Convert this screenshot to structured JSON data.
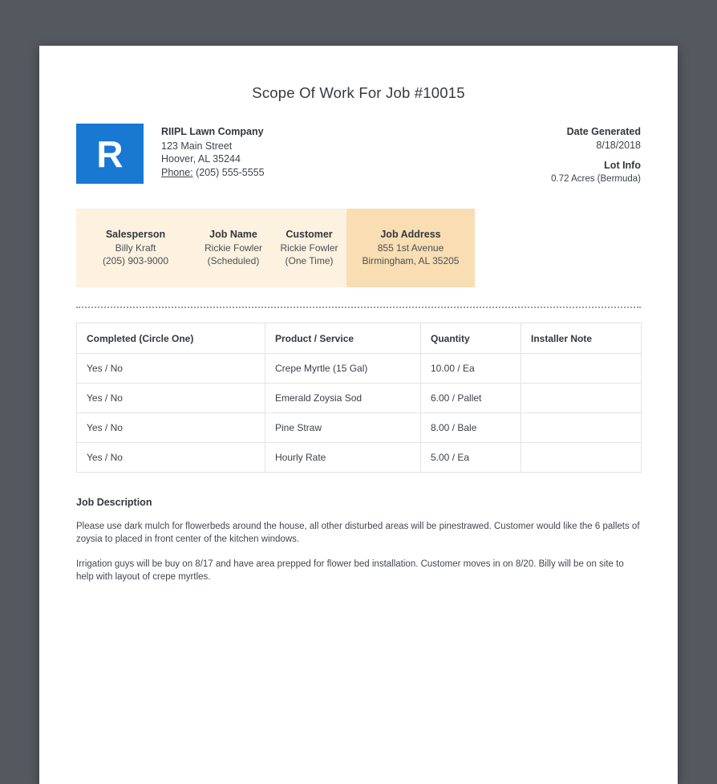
{
  "page": {
    "title": "Scope Of Work For Job #10015"
  },
  "company": {
    "logo_letter": "R",
    "name": "RIIPL Lawn Company",
    "address_line1": "123 Main Street",
    "address_line2": "Hoover, AL 35244",
    "phone_label": "Phone:",
    "phone": " (205) 555-5555"
  },
  "meta": {
    "date_generated_label": "Date Generated",
    "date_generated": "8/18/2018",
    "lot_info_label": "Lot Info",
    "lot_info": "0.72 Acres (Bermuda)"
  },
  "job_info": {
    "columns": [
      {
        "label": "Salesperson",
        "line1": "Billy Kraft",
        "line2": "(205) 903-9000"
      },
      {
        "label": "Job Name",
        "line1": "Rickie Fowler",
        "line2": "(Scheduled)"
      },
      {
        "label": "Customer",
        "line1": "Rickie Fowler",
        "line2": "(One Time)"
      },
      {
        "label": "Job Address",
        "line1": "855 1st Avenue",
        "line2": "Birmingham, AL 35205"
      }
    ]
  },
  "table": {
    "headers": [
      "Completed (Circle One)",
      "Product / Service",
      "Quantity",
      "Installer Note"
    ],
    "rows": [
      {
        "completed": "Yes / No",
        "product": "Crepe Myrtle (15 Gal)",
        "quantity": "10.00 / Ea",
        "installer_note": ""
      },
      {
        "completed": "Yes / No",
        "product": "Emerald Zoysia Sod",
        "quantity": "6.00 / Pallet",
        "installer_note": ""
      },
      {
        "completed": "Yes / No",
        "product": "Pine Straw",
        "quantity": "8.00 / Bale",
        "installer_note": ""
      },
      {
        "completed": "Yes / No",
        "product": "Hourly Rate",
        "quantity": "5.00 / Ea",
        "installer_note": ""
      }
    ]
  },
  "description": {
    "heading": "Job Description",
    "paragraphs": [
      "Please use dark mulch for flowerbeds around the house, all other disturbed areas will be pinestrawed. Customer would like the 6 pallets of zoysia to placed in front center of the kitchen windows.",
      "Irrigation guys will be buy on 8/17 and have area prepped for flower bed installation. Customer moves in on 8/20. Billy will be on site to help with layout of crepe myrtles."
    ]
  },
  "colors": {
    "viewer_background": "#54585f",
    "page_background": "#ffffff",
    "logo_blue": "#1878d2",
    "info_bar_background": "#fdf2df",
    "job_address_highlight": "#f8deb2",
    "table_border": "#e3e3e3",
    "text_dark": "#33373d"
  }
}
